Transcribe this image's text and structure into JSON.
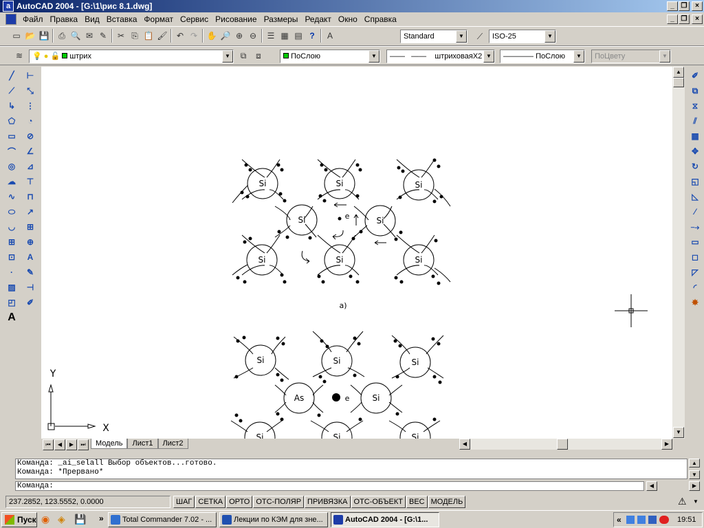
{
  "window": {
    "title": "AutoCAD 2004 - [G:\\1\\рис 8.1.dwg]"
  },
  "menu": [
    "Файл",
    "Правка",
    "Вид",
    "Вставка",
    "Формат",
    "Сервис",
    "Рисование",
    "Размеры",
    "Редакт",
    "Окно",
    "Справка"
  ],
  "toolbar": {
    "text_style": "Standard",
    "dim_style": "ISO-25",
    "layer": "штрих",
    "color": "ПоСлою",
    "linetype": "штриховаяX2",
    "lineweight": "ПоСлою",
    "plotstyle": "ПоЦвету"
  },
  "drawing": {
    "atom_si": "Si",
    "atom_as": "As",
    "electron": "e",
    "caption_a": "а)",
    "ucs_x": "X",
    "ucs_y": "Y"
  },
  "tabs": [
    "Модель",
    "Лист1",
    "Лист2"
  ],
  "command": {
    "lines": [
      "Команда: _ai_selall Выбор объектов...готово.",
      "Команда: *Прервано*"
    ],
    "prompt": "Команда:"
  },
  "status": {
    "coords": "237.2852, 123.5552, 0.0000",
    "buttons": [
      "ШАГ",
      "СЕТКА",
      "ОРТО",
      "ОТС-ПОЛЯР",
      "ПРИВЯЗКА",
      "ОТС-ОБЪЕКТ",
      "ВЕС",
      "МОДЕЛЬ"
    ]
  },
  "taskbar": {
    "start": "Пуск",
    "tasks": [
      "Total Commander 7.02 - ...",
      "Лекции по КЭМ для зне...",
      "AutoCAD 2004 - [G:\\1..."
    ],
    "time": "19:51"
  },
  "colors": {
    "title_start": "#0a246a",
    "title_end": "#a6caf0",
    "layer_swatch": "#00cc00"
  }
}
